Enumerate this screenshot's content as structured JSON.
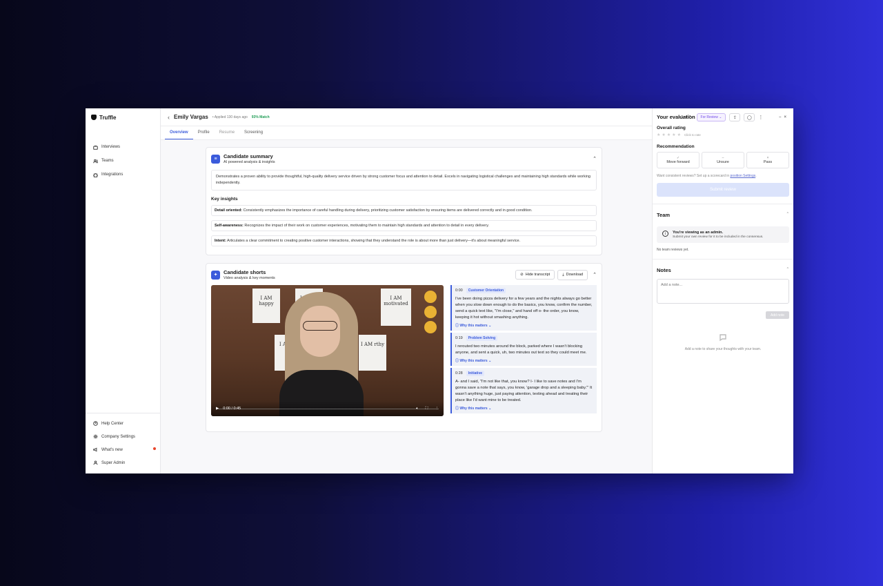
{
  "app": {
    "name": "Truffle"
  },
  "sidebar": {
    "nav": [
      {
        "label": "Interviews",
        "icon": "briefcase-icon"
      },
      {
        "label": "Teams",
        "icon": "users-icon"
      },
      {
        "label": "Integrations",
        "icon": "puzzle-icon"
      }
    ],
    "footer": [
      {
        "label": "Help Center",
        "icon": "help-icon"
      },
      {
        "label": "Company Settings",
        "icon": "gear-icon"
      },
      {
        "label": "What's new",
        "icon": "megaphone-icon"
      },
      {
        "label": "Super Admin",
        "icon": "user-icon"
      }
    ]
  },
  "header": {
    "candidate_name": "Emily Vargas",
    "applied": "Applied 130 days ago",
    "match": "93% Match",
    "pager": "1 of 7",
    "status": "For Review"
  },
  "tabs": [
    "Overview",
    "Profile",
    "Resume",
    "Screening"
  ],
  "summary": {
    "title": "Candidate summary",
    "subtitle": "AI powered analysis & insights",
    "text": "Demonstrates a proven ability to provide thoughtful, high-quality delivery service driven by strong customer focus and attention to detail. Excels in navigating logistical challenges and maintaining high standards while working independently.",
    "key_insights_title": "Key insights",
    "insights": [
      {
        "label": "Detail oriented:",
        "text": " Consistently emphasizes the importance of careful handling during delivery, prioritizing customer satisfaction by ensuring items are delivered correctly and in good condition."
      },
      {
        "label": "Self-awareness:",
        "text": " Recognizes the impact of their work on customer experiences, motivating them to maintain high standards and attention to detail in every delivery."
      },
      {
        "label": "Intent:",
        "text": " Articulates a clear commitment to creating positive customer interactions, showing that they understand the role is about more than just delivery—it's about meaningful service."
      }
    ]
  },
  "shorts": {
    "title": "Candidate shorts",
    "subtitle": "Video analysis & key moments",
    "hide_transcript": "Hide transcript",
    "download": "Download",
    "video_time": "0:00 / 0:45",
    "posters": [
      "I AM happy",
      "I AM fo",
      "I AM motivated",
      "I AM bl",
      "I AM rthy"
    ],
    "segments": [
      {
        "time": "0:00",
        "tag": "Customer Orientation",
        "text": "I've been doing pizza delivery for a few years and the nights always go better when you slow down enough to do the basics, you know, confirm the number, send a quick text like, \"I'm close,\" and hand off o- the order, you know, keeping it hot without smashing anything.",
        "why": "Why this matters"
      },
      {
        "time": "0:19",
        "tag": "Problem Solving",
        "text": "I rerouted two minutes around the block, parked where I wasn't blocking anyone, and sent a quick, uh, two minutes out text so they could meet me.",
        "why": "Why this matters"
      },
      {
        "time": "0:28",
        "tag": "Initiative",
        "text": "A- and I said, \"I'm not like that, you know? I- I like to save notes and I'm gonna save a note that says, you know, 'garage drop and a sleeping baby.'\" It wasn't anything huge, just paying attention, texting ahead and treating their place like I'd want mine to be treated.",
        "why": "Why this matters"
      }
    ]
  },
  "evaluation": {
    "title": "Your evaluation",
    "overall_rating": "Overall rating",
    "click_to_rate": "Click to rate",
    "recommendation": "Recommendation",
    "options": [
      {
        "symbol": "✓",
        "label": "Move forward"
      },
      {
        "symbol": "–",
        "label": "Unsure"
      },
      {
        "symbol": "×",
        "label": "Pass"
      }
    ],
    "consistent_text": "Want consistent reviews? Set up a scorecard in ",
    "consistent_link": "position Settings",
    "consistent_end": ".",
    "submit": "Submit review"
  },
  "team": {
    "title": "Team",
    "admin_title": "You're viewing as an admin.",
    "admin_sub": "Submit your own review for it to be included in the consensus.",
    "no_reviews": "No team reviews yet."
  },
  "notes": {
    "title": "Notes",
    "placeholder": "Add a note...",
    "add_button": "Add note",
    "empty": "Add a note to share your thoughts with your team."
  }
}
